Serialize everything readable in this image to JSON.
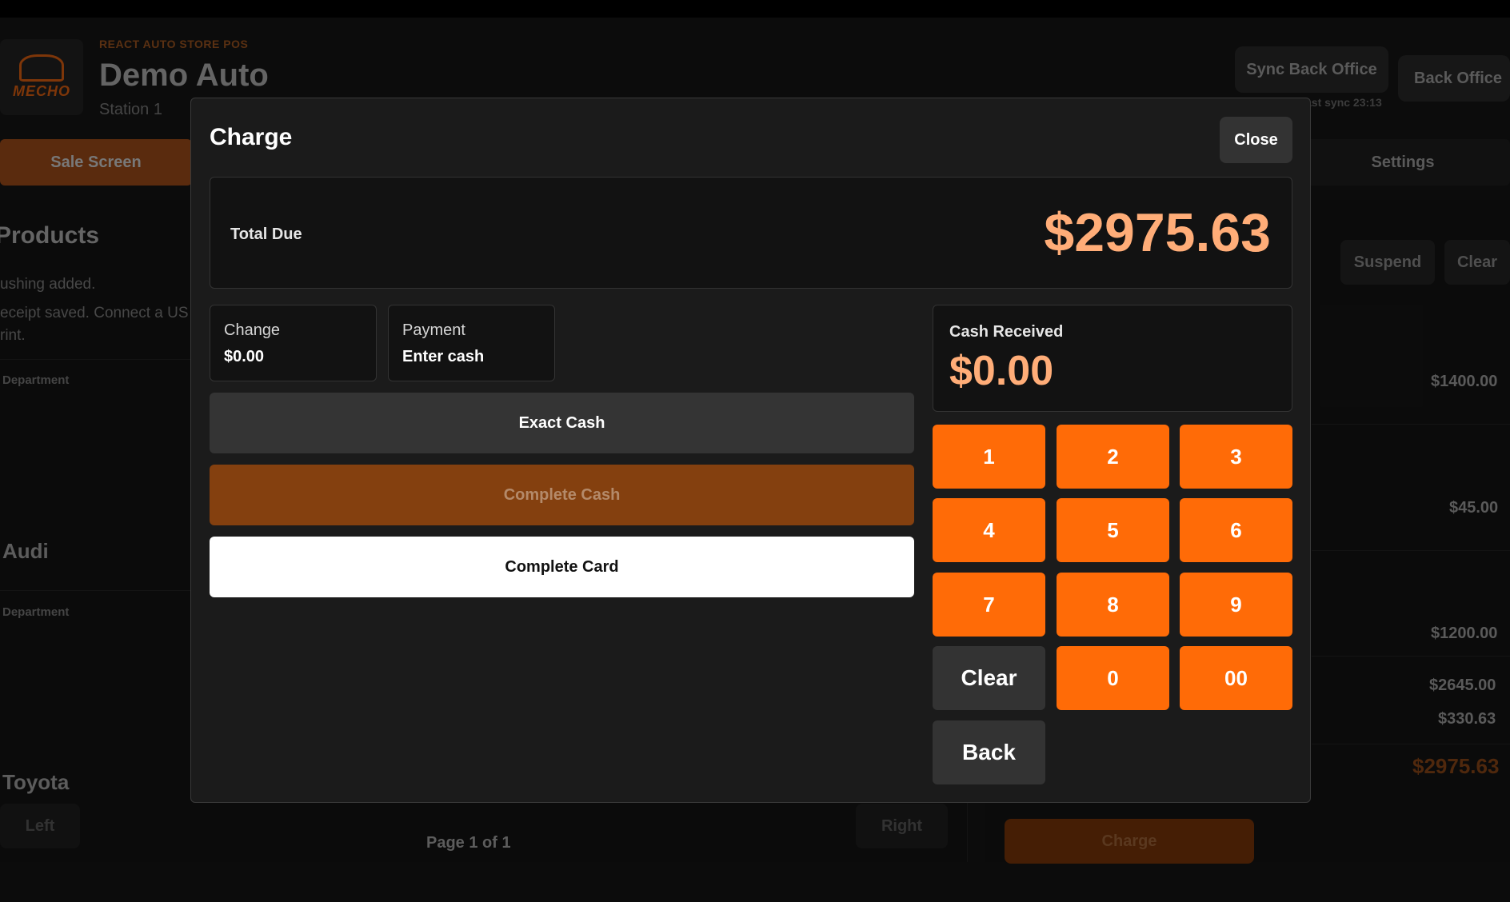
{
  "header": {
    "kicker": "REACT AUTO STORE POS",
    "store_name": "Demo Auto",
    "station": "Station 1",
    "logo_text": "MECHO",
    "sync_button": "Sync Back Office",
    "back_office_button": "Back Office",
    "last_sync": "ast sync 23:13"
  },
  "tabs": {
    "sale": "Sale Screen",
    "settings": "Settings"
  },
  "products": {
    "title": "Products",
    "messages": [
      "ushing added.",
      "eceipt saved. Connect a US",
      "rint."
    ],
    "rows": [
      {
        "department": "Department",
        "make": "Audi"
      },
      {
        "department": "Department",
        "make": "Toyota"
      }
    ],
    "pager": {
      "left": "Left",
      "label": "Page 1 of 1",
      "right": "Right"
    }
  },
  "cart": {
    "suspend": "Suspend",
    "clear": "Clear",
    "line_prices": [
      "$1400.00",
      "$45.00",
      "$1200.00"
    ],
    "subtotal": "$2645.00",
    "tax": "$330.63",
    "total": "$2975.63",
    "charge_button": "Charge"
  },
  "modal": {
    "title": "Charge",
    "close": "Close",
    "total_due_label": "Total Due",
    "total_due": "$2975.63",
    "change_label": "Change",
    "change_value": "$0.00",
    "payment_label": "Payment",
    "payment_value": "Enter cash",
    "exact_cash": "Exact Cash",
    "complete_cash": "Complete Cash",
    "complete_card": "Complete Card",
    "cash_received_label": "Cash Received",
    "cash_received": "$0.00",
    "keypad": [
      "1",
      "2",
      "3",
      "4",
      "5",
      "6",
      "7",
      "8",
      "9",
      "Clear",
      "0",
      "00",
      "Back"
    ]
  },
  "colors": {
    "accent": "#ff6b07",
    "amount": "#ffad78",
    "background": "#131313",
    "modal": "#1b1b1b"
  }
}
